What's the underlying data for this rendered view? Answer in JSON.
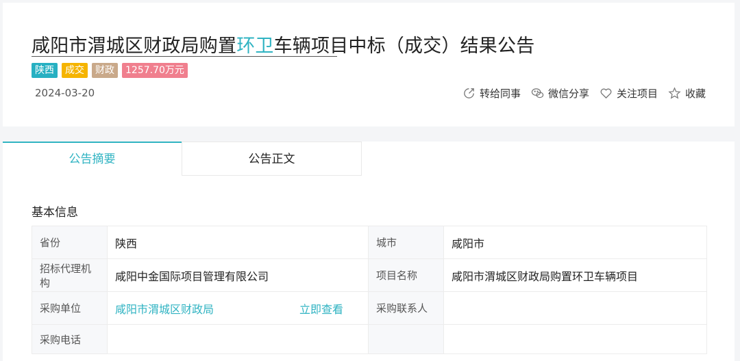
{
  "header": {
    "title_before": "咸阳市渭城区财政局购置",
    "title_highlight": "环卫",
    "title_after": "车辆项目中标（成交）结果公告",
    "tags": [
      {
        "label": "陕西",
        "color": "#27b0c2"
      },
      {
        "label": "成交",
        "color": "#f5b400"
      },
      {
        "label": "财政",
        "color": "#c9a98a"
      },
      {
        "label": "1257.70万元",
        "color": "#f07f8e"
      }
    ],
    "date": "2024-03-20",
    "actions": [
      {
        "label": "转给同事",
        "icon": "share-forward-icon"
      },
      {
        "label": "微信分享",
        "icon": "wechat-icon"
      },
      {
        "label": "关注项目",
        "icon": "heart-icon"
      },
      {
        "label": "收藏",
        "icon": "star-icon"
      }
    ]
  },
  "tabs": [
    {
      "label": "公告摘要",
      "active": true
    },
    {
      "label": "公告正文",
      "active": false
    }
  ],
  "section_title": "基本信息",
  "info": {
    "province_label": "省份",
    "province": "陕西",
    "city_label": "城市",
    "city": "咸阳市",
    "agency_label": "招标代理机构",
    "agency": "咸阳中金国际项目管理有限公司",
    "project_label": "项目名称",
    "project": "咸阳市渭城区财政局购置环卫车辆项目",
    "buyer_label": "采购单位",
    "buyer": "咸阳市渭城区财政局",
    "view_link": "立即查看",
    "contact_label": "采购联系人",
    "contact": "",
    "phone_label": "采购电话",
    "phone": ""
  },
  "colors": {
    "accent": "#2fb3c2"
  }
}
